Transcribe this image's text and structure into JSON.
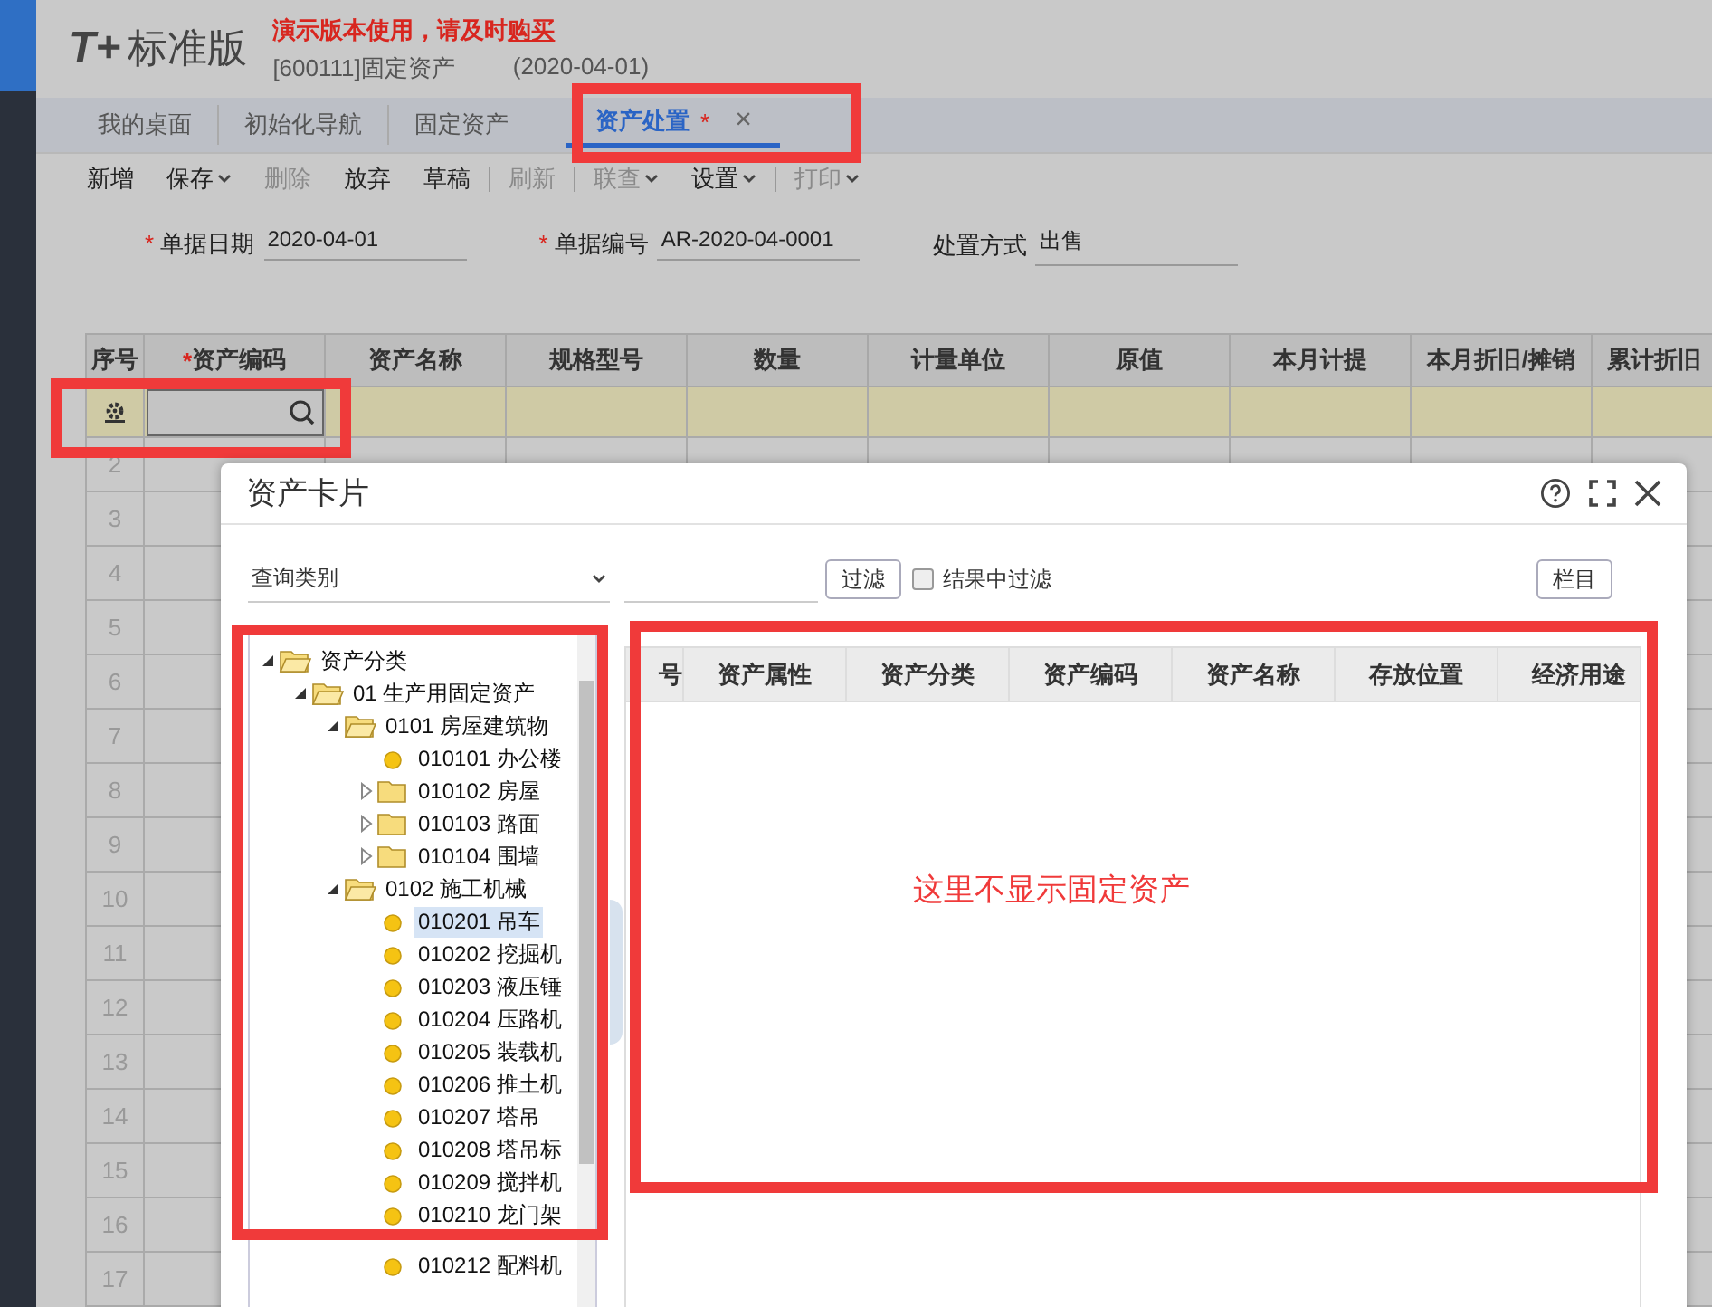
{
  "header": {
    "logo_mark": "T+",
    "logo_text": "标准版",
    "notice": {
      "text": "演示版本使用，请及时",
      "link": "购买"
    },
    "account": "[600111]固定资产",
    "date": "(2020-04-01)"
  },
  "tabs": [
    {
      "label": "我的桌面",
      "selected": false
    },
    {
      "label": "初始化导航",
      "selected": false
    },
    {
      "label": "固定资产",
      "selected": false
    },
    {
      "label": "资产处置",
      "selected": true,
      "modified_mark": "*",
      "close": "×"
    }
  ],
  "toolbar": [
    {
      "kind": "button",
      "label": "新增",
      "disabled": false,
      "menu": false
    },
    {
      "kind": "button",
      "label": "保存",
      "disabled": false,
      "menu": true
    },
    {
      "kind": "button",
      "label": "删除",
      "disabled": true,
      "menu": false
    },
    {
      "kind": "button",
      "label": "放弃",
      "disabled": false,
      "menu": false
    },
    {
      "kind": "button",
      "label": "草稿",
      "disabled": false,
      "menu": false
    },
    {
      "kind": "separator"
    },
    {
      "kind": "button",
      "label": "刷新",
      "disabled": true,
      "menu": false
    },
    {
      "kind": "separator"
    },
    {
      "kind": "button",
      "label": "联查",
      "disabled": true,
      "menu": true
    },
    {
      "kind": "button",
      "label": "设置",
      "disabled": false,
      "menu": true
    },
    {
      "kind": "separator"
    },
    {
      "kind": "button",
      "label": "打印",
      "disabled": true,
      "menu": true
    }
  ],
  "form": [
    {
      "label": "单据日期",
      "required_mark": "*",
      "value": "2020-04-01"
    },
    {
      "label": "单据编号",
      "required_mark": "*",
      "value": "AR-2020-04-0001"
    },
    {
      "label": "处置方式",
      "value": "出售"
    }
  ],
  "grid": {
    "columns": [
      {
        "label": "序号"
      },
      {
        "label": "资产编码",
        "required_mark": "*"
      },
      {
        "label": "资产名称"
      },
      {
        "label": "规格型号"
      },
      {
        "label": "数量"
      },
      {
        "label": "计量单位"
      },
      {
        "label": "原值"
      },
      {
        "label": "本月计提"
      },
      {
        "label": "本月折旧/摊销"
      },
      {
        "label": "累计折旧"
      }
    ],
    "rows": [
      {
        "number": "",
        "selected": true
      },
      {
        "number": "2",
        "selected": false
      },
      {
        "number": "3",
        "selected": false
      },
      {
        "number": "4",
        "selected": false
      },
      {
        "number": "5",
        "selected": false
      },
      {
        "number": "6",
        "selected": false
      },
      {
        "number": "7",
        "selected": false
      },
      {
        "number": "8",
        "selected": false
      },
      {
        "number": "9",
        "selected": false
      },
      {
        "number": "10",
        "selected": false
      },
      {
        "number": "11",
        "selected": false
      },
      {
        "number": "12",
        "selected": false
      },
      {
        "number": "13",
        "selected": false
      },
      {
        "number": "14",
        "selected": false
      },
      {
        "number": "15",
        "selected": false
      },
      {
        "number": "16",
        "selected": false
      },
      {
        "number": "17",
        "selected": false
      }
    ]
  },
  "dialog": {
    "title": "资产卡片",
    "filter": {
      "category": "查询类别",
      "button": "过滤",
      "filter_in_results": {
        "label": "结果中过滤",
        "checked": false
      },
      "columns_button": "栏目"
    },
    "tree": [
      {
        "kind": "folder",
        "label": "资产分类",
        "expanded": true,
        "selected": false,
        "children": [
          {
            "kind": "folder",
            "label": "01 生产用固定资产",
            "expanded": true,
            "selected": false,
            "children": [
              {
                "kind": "folder",
                "label": "0101 房屋建筑物",
                "expanded": true,
                "selected": false,
                "children": [
                  {
                    "kind": "leaf",
                    "label": "010101 办公楼",
                    "selected": false
                  },
                  {
                    "kind": "folder",
                    "label": "010102 房屋",
                    "expanded": false,
                    "selected": false
                  },
                  {
                    "kind": "folder",
                    "label": "010103 路面",
                    "expanded": false,
                    "selected": false
                  },
                  {
                    "kind": "folder",
                    "label": "010104 围墙",
                    "expanded": false,
                    "selected": false
                  }
                ]
              },
              {
                "kind": "folder",
                "label": "0102 施工机械",
                "expanded": true,
                "selected": false,
                "children": [
                  {
                    "kind": "leaf",
                    "label": "010201 吊车",
                    "selected": true
                  },
                  {
                    "kind": "leaf",
                    "label": "010202 挖掘机",
                    "selected": false
                  },
                  {
                    "kind": "leaf",
                    "label": "010203 液压锤",
                    "selected": false
                  },
                  {
                    "kind": "leaf",
                    "label": "010204 压路机",
                    "selected": false
                  },
                  {
                    "kind": "leaf",
                    "label": "010205 装载机",
                    "selected": false
                  },
                  {
                    "kind": "leaf",
                    "label": "010206 推土机",
                    "selected": false
                  },
                  {
                    "kind": "leaf",
                    "label": "010207 塔吊",
                    "selected": false
                  },
                  {
                    "kind": "leaf",
                    "label": "010208 塔吊标",
                    "selected": false
                  },
                  {
                    "kind": "leaf",
                    "label": "010209 搅拌机",
                    "selected": false
                  },
                  {
                    "kind": "leaf",
                    "label": "010210 龙门架",
                    "selected": false
                  },
                  {
                    "kind": "leaf",
                    "label": "010212 配料机",
                    "selected": false
                  }
                ]
              }
            ]
          }
        ]
      }
    ],
    "table": {
      "columns": [
        "号",
        "资产属性",
        "资产分类",
        "资产编码",
        "资产名称",
        "存放位置",
        "经济用途"
      ]
    },
    "annotation": "这里不显示固定资产"
  }
}
